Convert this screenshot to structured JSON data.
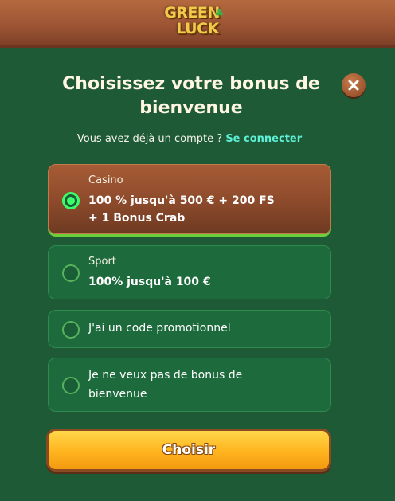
{
  "header": {
    "logo_line1": "GREEN",
    "logo_line2": "LUCK"
  },
  "modal": {
    "title": "Choisissez votre bonus de bienvenue",
    "account_prompt": "Vous avez déjà un compte ?",
    "login_link": "Se connecter"
  },
  "options": [
    {
      "label": "Casino",
      "value_line1": "100 % jusqu'à 500 € + 200 FS",
      "value_line2": "+ 1 Bonus Crab",
      "selected": true
    },
    {
      "label": "Sport",
      "value_line1": "100% jusqu'à 100 €",
      "selected": false
    },
    {
      "text": "J'ai un code promotionnel",
      "selected": false
    },
    {
      "text_line1": "Je ne veux pas de bonus de",
      "text_line2": "bienvenue",
      "selected": false
    }
  ],
  "cta": {
    "label": "Choisir"
  },
  "colors": {
    "background": "#1f5a37",
    "selected_radio": "#3aff6a",
    "link": "#5ff0d8",
    "cta": "#ffb41e"
  },
  "icons": {
    "close": "close-icon",
    "logo_clover": "clover-icon"
  }
}
